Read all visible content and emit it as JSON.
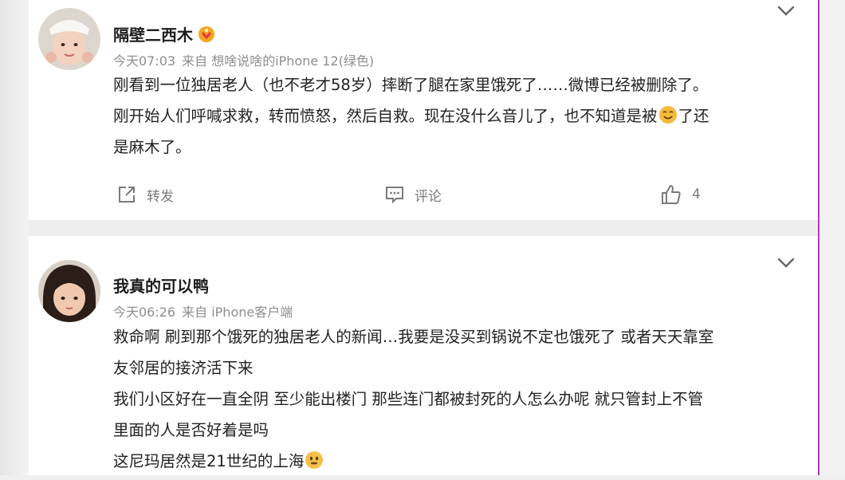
{
  "comments": [
    {
      "username": "隔壁二西木",
      "time": "今天07:03",
      "source": "来自 想啥说啥的iPhone 12(绿色)",
      "lines": [
        "刚看到一位独居老人（也不老才58岁）摔断了腿在家里饿死了……微博已经被删除了。",
        "刚开始人们呼喊求救，转而愤怒，然后自救。现在没什么音儿了，也不知道是被",
        "了还",
        "是麻木了。"
      ],
      "emoji_icon": "smirk-emoji-icon",
      "actions": {
        "repost_label": "转发",
        "comment_label": "评论",
        "like_count": "4"
      }
    },
    {
      "username": "我真的可以鸭",
      "time": "今天06:26",
      "source": "来自 iPhone客户端",
      "lines": [
        "救命啊 刷到那个饿死的独居老人的新闻…我要是没买到锅说不定也饿死了 或者天天靠室",
        "友邻居的接济活下来",
        "我们小区好在一直全阴 至少能出楼门 那些连门都被封死的人怎么办呢 就只管封上不管",
        "里面的人是否好着是吗",
        "这尼玛居然是21世纪的上海"
      ],
      "emoji_icon": "speechless-emoji-icon"
    }
  ],
  "colors": {
    "text": "#222222",
    "meta": "#8e8e8e",
    "action": "#7a7a7a",
    "emoji": "#f5b93a"
  }
}
